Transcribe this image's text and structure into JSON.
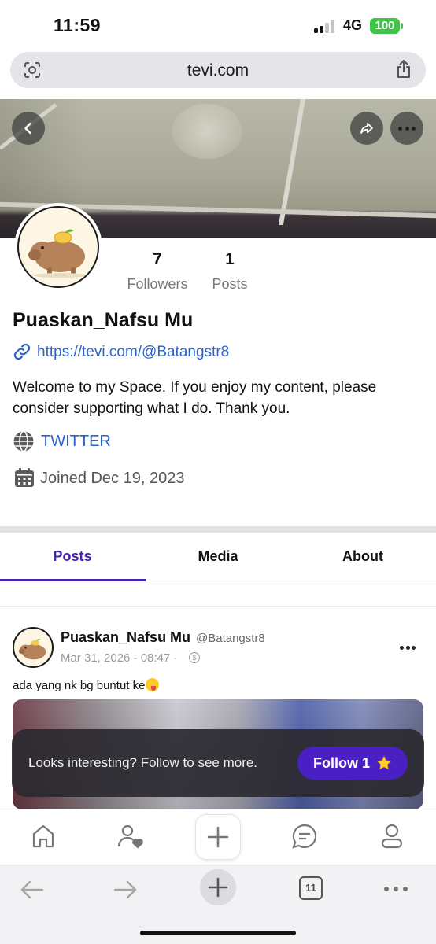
{
  "status_bar": {
    "time": "11:59",
    "network": "4G",
    "battery": "100"
  },
  "browser": {
    "url": "tevi.com",
    "tab_count": "11"
  },
  "profile": {
    "name": "Puaskan_Nafsu Mu",
    "followers_count": "7",
    "followers_label": "Followers",
    "posts_count": "1",
    "posts_label": "Posts",
    "link": "https://tevi.com/@Batangstr8",
    "bio": "Welcome to my Space. If you enjoy my content, please consider supporting what I do. Thank you.",
    "social_link": "TWITTER",
    "joined": "Joined Dec 19, 2023"
  },
  "tabs": [
    {
      "label": "Posts",
      "active": true
    },
    {
      "label": "Media",
      "active": false
    },
    {
      "label": "About",
      "active": false
    }
  ],
  "post": {
    "author": "Puaskan_Nafsu Mu",
    "handle": "@Batangstr8",
    "date": "Mar 31, 2026 - 08:47 ·",
    "coin_symbol": "$",
    "text": "ada yang nk bg buntut ke"
  },
  "toast": {
    "message": "Looks interesting? Follow to see more.",
    "button": "Follow 1"
  },
  "colors": {
    "accent": "#4524b5",
    "link": "#2b63c9",
    "follow_button": "#4a1fc4"
  },
  "icons": [
    "back-icon",
    "share-icon",
    "more-icon",
    "link-icon",
    "globe-icon",
    "calendar-icon",
    "home-icon",
    "user-heart-icon",
    "plus-icon",
    "chat-icon",
    "profile-icon",
    "star-icon"
  ]
}
